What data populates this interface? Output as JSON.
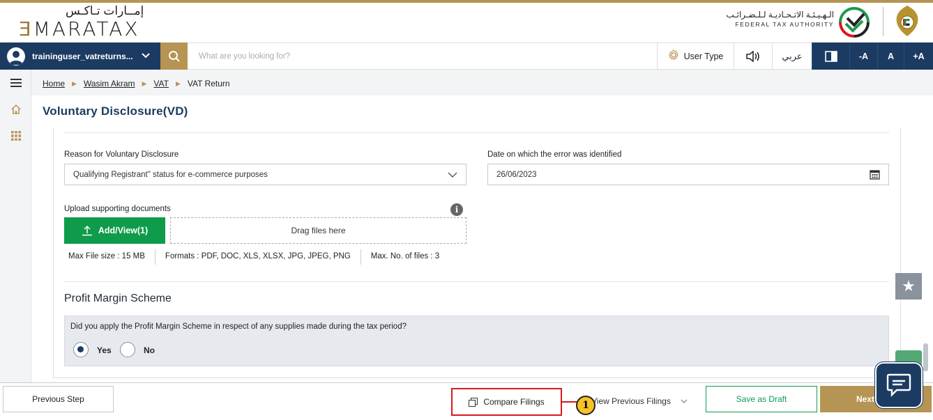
{
  "app": {
    "logo_arabic": "إمــارات تـاكـس",
    "logo_en_prefix": "Ǝ",
    "logo_en": "MARATAX",
    "authority_arabic": "الـهـيـئـة الاتـحـاديـة لـلـضـرائـب",
    "authority_en": "FEDERAL TAX AUTHORITY"
  },
  "nav": {
    "username": "traininguser_vatreturns...",
    "search_placeholder": "What are you looking for?",
    "user_type": "User Type",
    "arabic": "عربي",
    "font_minus": "-A",
    "font_normal": "A",
    "font_plus": "+A"
  },
  "breadcrumb": {
    "home": "Home",
    "taxpayer": "Wasim Akram",
    "vat": "VAT",
    "current": "VAT Return"
  },
  "page_title": "Voluntary Disclosure(VD)",
  "form": {
    "reason_label": "Reason for Voluntary Disclosure",
    "reason_value": "Qualifying Registrant\" status for e-commerce purposes",
    "date_label": "Date on which the error was identified",
    "date_value": "26/06/2023",
    "upload_label": "Upload supporting documents",
    "add_view": "Add/View(1)",
    "drag_files": "Drag files here",
    "max_size": "Max File size : 15 MB",
    "formats": "Formats : PDF, DOC, XLS, XLSX, JPG, JPEG, PNG",
    "max_files": "Max. No. of files : 3"
  },
  "profit_margin": {
    "title": "Profit Margin Scheme",
    "question": "Did you apply the Profit Margin Scheme in respect of any supplies made during the tax period?",
    "yes": "Yes",
    "no": "No",
    "selected": "Yes"
  },
  "footer": {
    "previous_step": "Previous Step",
    "compare_filings": "Compare Filings",
    "callout_number": "1",
    "view_previous": "View Previous Filings",
    "save_draft": "Save as Draft",
    "next": "Next"
  },
  "colors": {
    "brand_navy": "#1c3b62",
    "brand_gold": "#b69453",
    "action_green": "#0f9b4c",
    "highlight_red": "#d7191f"
  }
}
